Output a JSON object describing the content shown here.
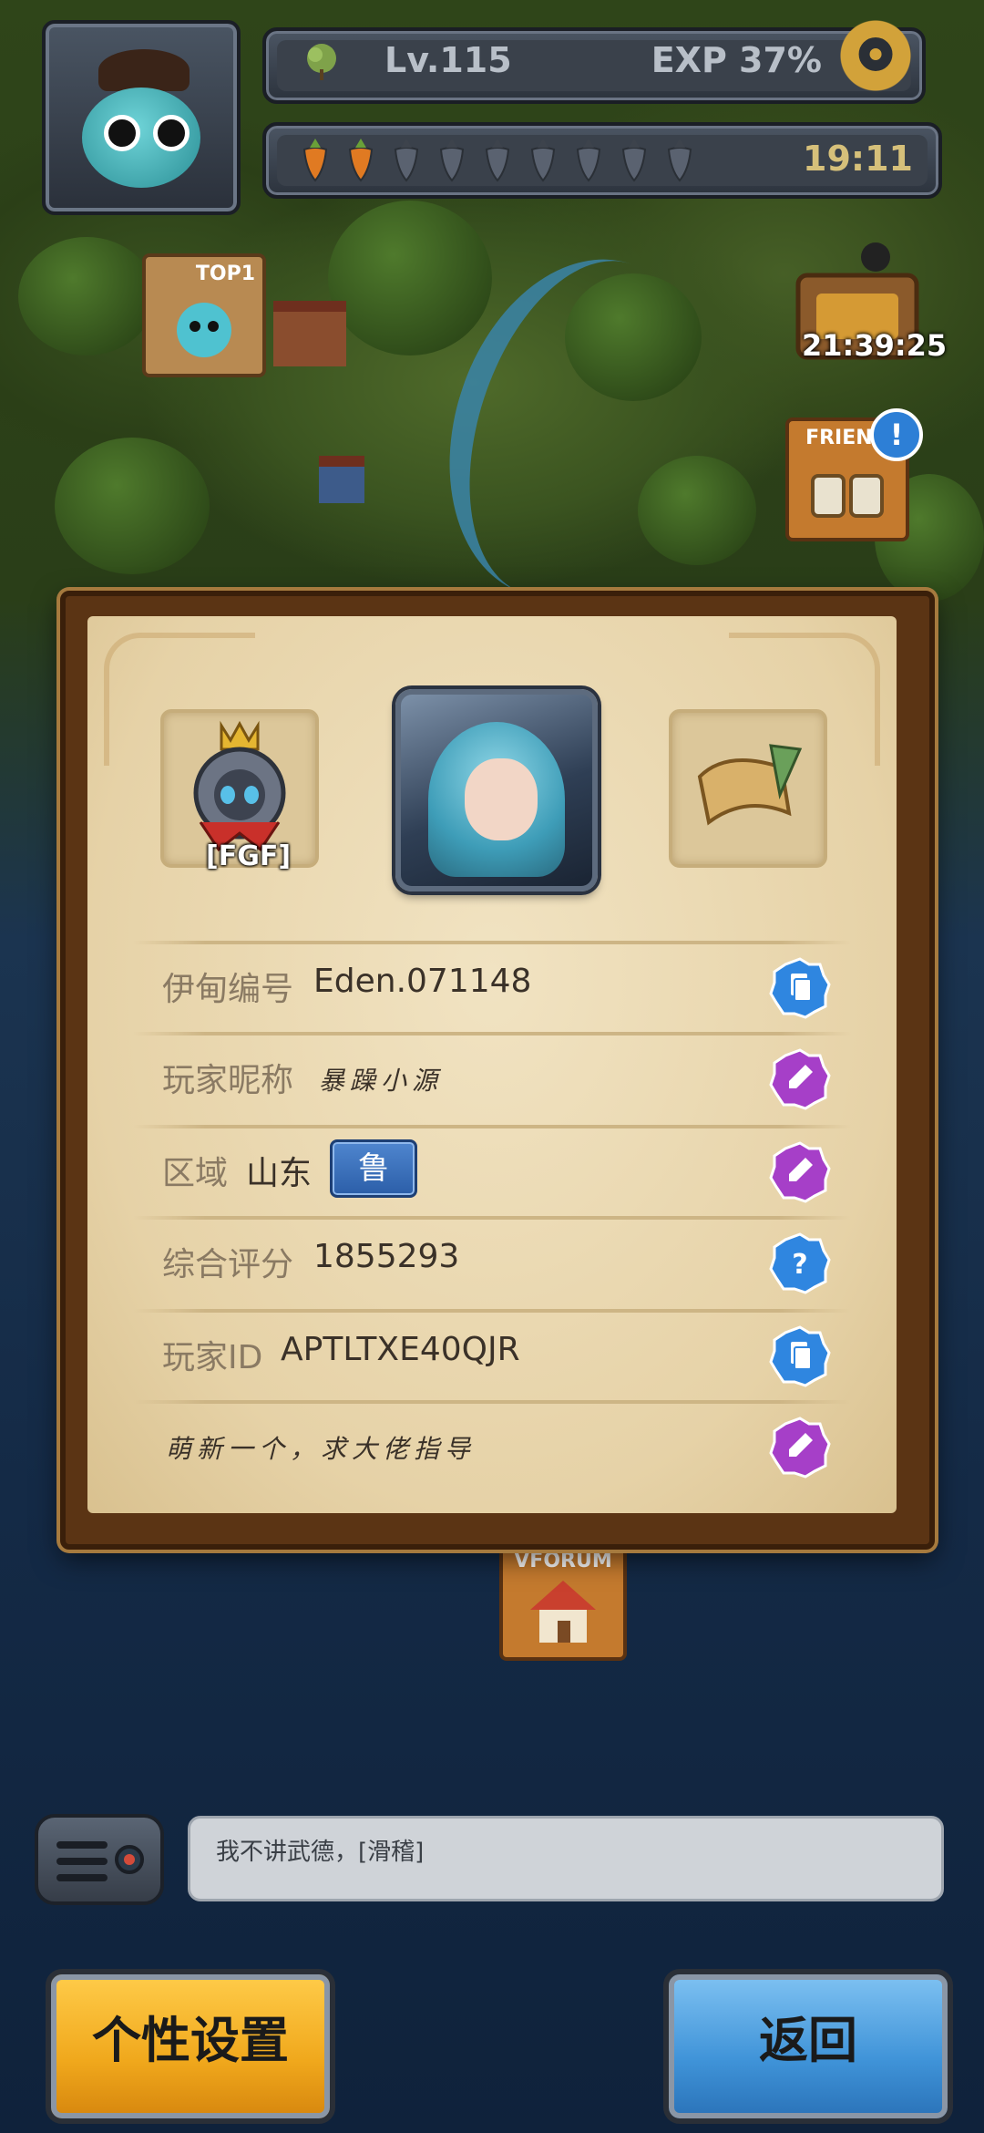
{
  "hud": {
    "level": "Lv.115",
    "exp": "EXP 37%",
    "stamina_timer": "19:11",
    "stamina": {
      "filled": 2,
      "total": 9
    },
    "chest_timer": "21:39:25"
  },
  "map": {
    "top1_sign": "TOP1",
    "friend_sign": "FRIEND",
    "friend_alert": "!",
    "vforum_sign": "VFORUM"
  },
  "profile": {
    "guild_tag": "[FGF]",
    "rows": [
      {
        "label": "伊甸编号",
        "value": "Eden.071148",
        "action": "copy"
      },
      {
        "label": "玩家昵称",
        "value": "暴躁小源",
        "action": "edit"
      },
      {
        "label": "区域",
        "value": "山东",
        "badge": "鲁",
        "action": "edit"
      },
      {
        "label": "综合评分",
        "value": "1855293",
        "action": "help"
      },
      {
        "label": "玩家ID",
        "value": "APTLTXE40QJR",
        "action": "copy"
      },
      {
        "label": "",
        "value": "萌新一个，求大佬指导",
        "action": "edit"
      }
    ]
  },
  "chat": {
    "message": "我不讲武德，[滑稽]"
  },
  "buttons": {
    "settings": "个性设置",
    "back": "返回"
  },
  "colors": {
    "copy": "#2f86e0",
    "edit": "#a63fc8",
    "help": "#2f86e0",
    "panel": "#e9d7ae"
  }
}
